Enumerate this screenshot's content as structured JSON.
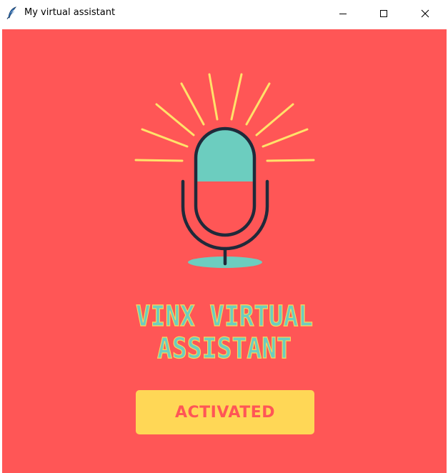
{
  "window": {
    "title": "My virtual assistant",
    "icon": "feather-icon",
    "controls": [
      "minimize-icon",
      "maximize-icon",
      "close-icon"
    ]
  },
  "logo": {
    "line1": "VINX VIRTUAL",
    "line2": "ASSISTANT"
  },
  "status_button": {
    "label": "ACTIVATED"
  },
  "colors": {
    "background": "#ff5656",
    "accent_teal": "#6ccdbf",
    "accent_yellow": "#ffd756",
    "rays_yellow": "#ffe26a",
    "outline_dark": "#1f2a3a",
    "title_bar": "#ffffff"
  }
}
